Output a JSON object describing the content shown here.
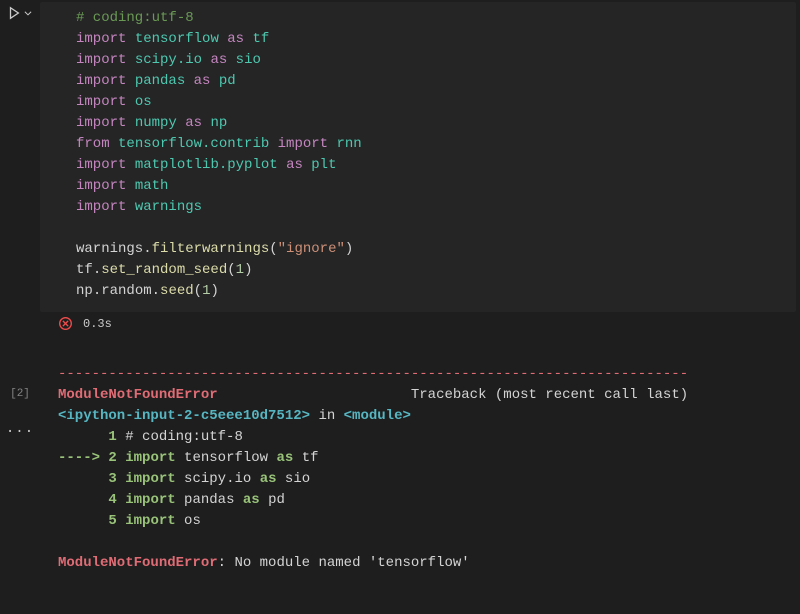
{
  "exec_count": "[2]",
  "elapsed": "0.3s",
  "code": {
    "l1_cmt": "# coding:utf-8",
    "kw_import": "import",
    "kw_from": "from",
    "kw_as": "as",
    "m_tf": "tensorflow",
    "a_tf": "tf",
    "m_sio": "scipy.io",
    "a_sio": "sio",
    "m_pd": "pandas",
    "a_pd": "pd",
    "m_os": "os",
    "m_np": "numpy",
    "a_np": "np",
    "m_tfc": "tensorflow.contrib",
    "m_rnn": "rnn",
    "m_plt": "matplotlib.pyplot",
    "a_plt": "plt",
    "m_math": "math",
    "m_warn": "warnings",
    "id_warn": "warnings",
    "fn_fw": "filterwarnings",
    "s_ignore": "\"ignore\"",
    "id_tf": "tf",
    "fn_srs": "set_random_seed",
    "n_1a": "1",
    "id_np": "np",
    "attr_rand": "random",
    "fn_seed": "seed",
    "n_1b": "1"
  },
  "out": {
    "dashes": "---------------------------------------------------------------------------",
    "err_name": "ModuleNotFoundError",
    "tb_pad": "                       ",
    "tb": "Traceback (most recent call last)",
    "ipy": "<ipython-input-2-c5eee10d7512>",
    "in": " in ",
    "mod": "<module>",
    "ln1_pre": "      ",
    "ln1_num": "1 ",
    "ln1_txt": "# coding:utf-8",
    "arrow": "----> ",
    "ln2_num": "2 ",
    "ln2_kw": "import",
    "ln2_sp": " tensorflow ",
    "ln2_as": "as",
    "ln2_al": " tf",
    "ln3_pre": "      ",
    "ln3_num": "3 ",
    "ln3_kw": "import",
    "ln3_sp": " scipy",
    "ln3_dot": ".",
    "ln3_io": "io ",
    "ln3_as": "as",
    "ln3_al": " sio",
    "ln4_pre": "      ",
    "ln4_num": "4 ",
    "ln4_kw": "import",
    "ln4_sp": " pandas ",
    "ln4_as": "as",
    "ln4_al": " pd",
    "ln5_pre": "      ",
    "ln5_num": "5 ",
    "ln5_kw": "import",
    "ln5_sp": " os",
    "final_err": "ModuleNotFoundError",
    "final_colon": ": ",
    "final_msg": "No module named 'tensorflow'"
  }
}
